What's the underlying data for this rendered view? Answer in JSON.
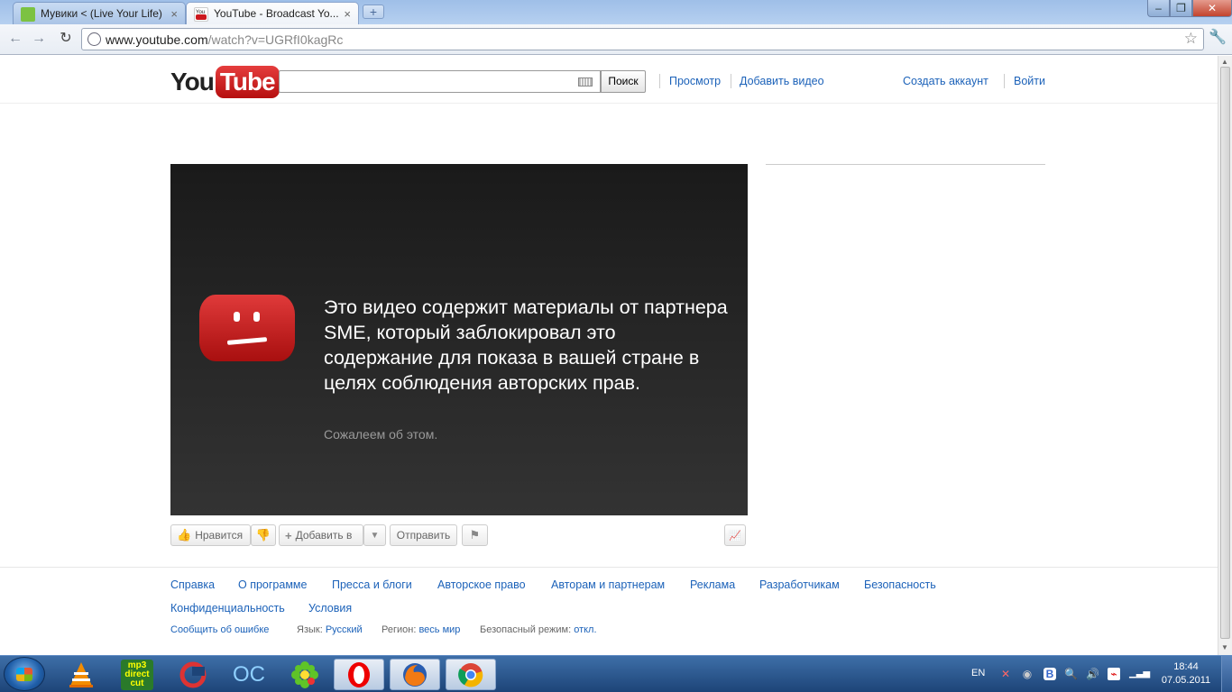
{
  "browser": {
    "tabs": [
      {
        "title": "Мувики < (Live Your Life)",
        "active": false,
        "favicon_color": "#7cc242"
      },
      {
        "title": "YouTube - Broadcast Yo...",
        "active": true,
        "favicon_color": "#cc181e"
      }
    ],
    "newtab_label": "+",
    "url_host": "www.youtube.com",
    "url_path": "/watch?v=UGRfI0kagRc",
    "window_controls": {
      "minimize": "–",
      "maximize": "❐",
      "close": "✕"
    }
  },
  "youtube": {
    "logo_you": "You",
    "logo_tube": "Tube",
    "search": {
      "value": "",
      "button": "Поиск"
    },
    "nav": {
      "browse": "Просмотр",
      "upload": "Добавить видео",
      "create_account": "Создать аккаунт",
      "sign_in": "Войти"
    },
    "player": {
      "message": "Это видео содержит материалы от партнера SME, который заблокировал это содержание для показа в вашей стране в целях соблюдения авторских прав.",
      "sorry": "Сожалеем об этом."
    },
    "actions": {
      "like": "Нравится",
      "add_to": "Добавить в",
      "share": "Отправить"
    },
    "footer": {
      "links_row1": [
        "Справка",
        "О программе",
        "Пресса и блоги",
        "Авторское право",
        "Авторам и партнерам",
        "Реклама",
        "Разработчикам",
        "Безопасность"
      ],
      "links_row2": [
        "Конфиденциальность",
        "Условия"
      ],
      "report_bug": "Сообщить об ошибке",
      "language_label": "Язык:",
      "language_value": "Русский",
      "region_label": "Регион:",
      "region_value": "весь мир",
      "safety_label": "Безопасный режим:",
      "safety_value": "откл."
    }
  },
  "taskbar": {
    "mp3_label": "mp3 direct cut",
    "oc_label": "OC",
    "lang": "EN",
    "vk_label": "B",
    "time": "18:44",
    "date": "07.05.2011"
  },
  "colors": {
    "link": "#1c62b9",
    "yt_red": "#cc181e"
  }
}
